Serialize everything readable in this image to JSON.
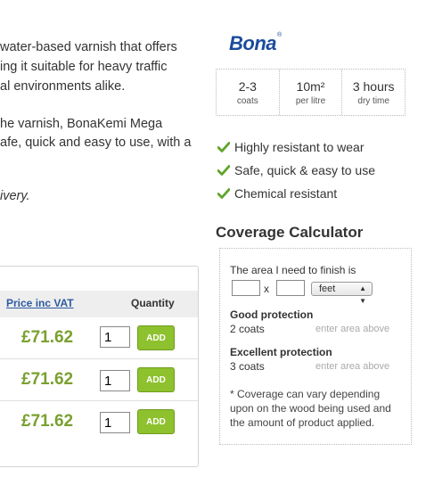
{
  "description": {
    "lines": [
      "water-based varnish that offers",
      "ing it suitable for heavy traffic",
      "al environments alike.",
      "he varnish, BonaKemi Mega",
      "afe, quick and easy to use, with a",
      "ivery."
    ]
  },
  "table": {
    "price_header": "Price inc VAT",
    "qty_header": "Quantity",
    "rows": [
      {
        "price": "£71.62",
        "qty": "1",
        "add": "ADD"
      },
      {
        "price": "£71.62",
        "qty": "1",
        "add": "ADD"
      },
      {
        "price": "£71.62",
        "qty": "1",
        "add": "ADD"
      }
    ]
  },
  "brand": {
    "name": "Bona",
    "mark": "®",
    "color": "#1a4b9c"
  },
  "specs": [
    {
      "value": "2-3",
      "unit": "coats"
    },
    {
      "value": "10m²",
      "unit": "per litre"
    },
    {
      "value": "3 hours",
      "unit": "dry time"
    }
  ],
  "features": [
    {
      "icon": "check-icon",
      "text": "Highly resistant to wear"
    },
    {
      "icon": "check-icon",
      "text": "Safe, quick & easy to use"
    },
    {
      "icon": "check-icon",
      "text": "Chemical resistant"
    }
  ],
  "calculator": {
    "title": "Coverage Calculator",
    "area_label": "The area I need to finish is",
    "times": "x",
    "unit_selected": "feet",
    "good_label": "Good protection",
    "good_coats": "2 coats",
    "good_hint": "enter area above",
    "excellent_label": "Excellent protection",
    "excellent_coats": "3 coats",
    "excellent_hint": "enter area above",
    "note": "* Coverage can vary depending upon on the wood being used and the amount of product applied."
  },
  "colors": {
    "price_green": "#7aa02f",
    "add_green": "#8ec12e",
    "check_green": "#5fa52a",
    "link_blue": "#2c5aa0"
  }
}
